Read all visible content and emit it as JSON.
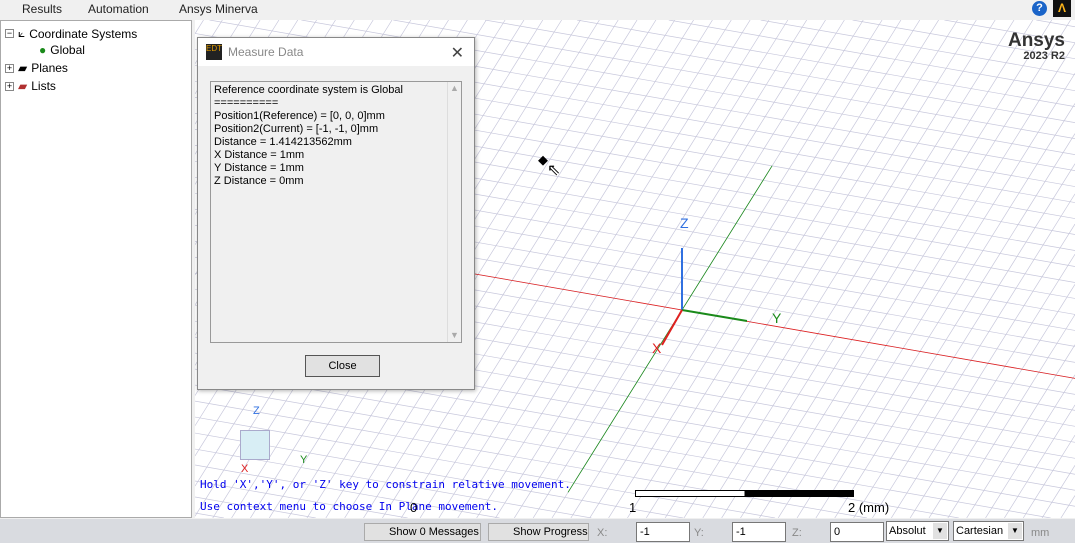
{
  "menu": [
    "Results",
    "Automation",
    "Ansys Minerva"
  ],
  "tree": {
    "coordinate_systems": "Coordinate Systems",
    "global": "Global",
    "planes": "Planes",
    "lists": "Lists"
  },
  "brand": {
    "name": "Ansys",
    "version": "2023 R2"
  },
  "dialog": {
    "title": "Measure Data",
    "lines": [
      "Reference coordinate system is Global",
      "==========",
      "Position1(Reference) = [0, 0, 0]mm",
      "Position2(Current) = [-1, -1, 0]mm",
      "Distance = 1.414213562mm",
      "X Distance = 1mm",
      "Y Distance = 1mm",
      "Z Distance = 0mm"
    ],
    "close": "Close"
  },
  "hints": [
    "Hold 'X','Y', or 'Z' key to constrain relative movement.",
    "Use context menu to choose In Plane movement."
  ],
  "scale": {
    "ticks": [
      "0",
      "1",
      "2 (mm)"
    ]
  },
  "axes": {
    "x": "X",
    "y": "Y",
    "z": "Z"
  },
  "status": {
    "messages": "Show 0 Messages",
    "progress": "Show Progress",
    "x_label": "X:",
    "x": "-1",
    "y_label": "Y:",
    "y": "-1",
    "z_label": "Z:",
    "z": "0",
    "mode": "Absolut",
    "coord": "Cartesian",
    "unit": "mm"
  },
  "colors": {
    "x_axis": "#e02020",
    "y_axis": "#1a8a1a",
    "z_axis": "#3070e0",
    "hint": "#0000ee"
  }
}
